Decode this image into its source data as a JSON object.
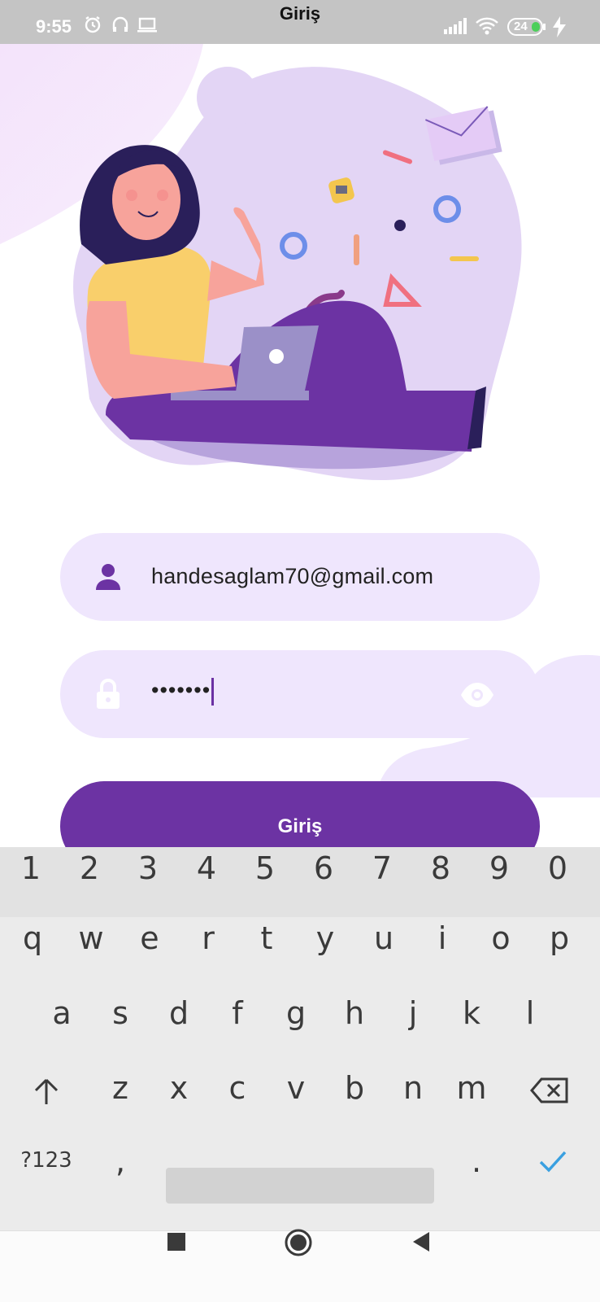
{
  "status_bar": {
    "time": "9:55",
    "title": "Giriş",
    "battery": "24",
    "icons": [
      "alarm-icon",
      "headset-icon",
      "laptop-icon",
      "signal-icon",
      "wifi-icon",
      "battery-icon",
      "charging-icon"
    ]
  },
  "form": {
    "email_value": "handesaglam70@gmail.com",
    "password_value": "•••••••",
    "login_label": "Giriş",
    "icons": [
      "person-icon",
      "lock-icon",
      "eye-icon"
    ]
  },
  "keyboard": {
    "number_row": [
      "1",
      "2",
      "3",
      "4",
      "5",
      "6",
      "7",
      "8",
      "9",
      "0"
    ],
    "row1": [
      "q",
      "w",
      "e",
      "r",
      "t",
      "y",
      "u",
      "i",
      "o",
      "p"
    ],
    "row2": [
      "a",
      "s",
      "d",
      "f",
      "g",
      "h",
      "j",
      "k",
      "l"
    ],
    "row3": [
      "z",
      "x",
      "c",
      "v",
      "b",
      "n",
      "m"
    ],
    "symbols_label": "?123",
    "comma": ",",
    "period": "."
  },
  "colors": {
    "primary": "#6c33a3",
    "field_bg": "#efe6fd",
    "blob": "#e3d5f5"
  }
}
